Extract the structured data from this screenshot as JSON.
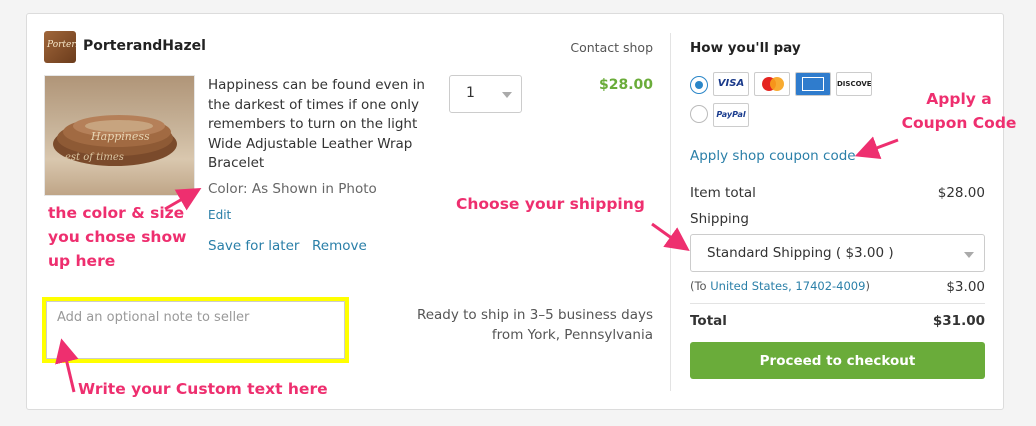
{
  "shop": {
    "name": "PorterandHazel",
    "logo_text": "PorterHazel",
    "contact_label": "Contact shop"
  },
  "item": {
    "title": "Happiness can be found even in the darkest of times if one only remembers to turn on the light Wide Adjustable Leather Wrap Bracelet",
    "image_text": [
      "Happiness",
      "est of times"
    ],
    "color": "Color: As Shown in Photo",
    "edit_label": "Edit",
    "save_label": "Save for later",
    "remove_label": "Remove",
    "quantity": "1",
    "price": "$28.00",
    "note_placeholder": "Add an optional note to seller",
    "ships_line1": "Ready to ship in 3–5 business days",
    "ships_line2": "from York, Pennsylvania"
  },
  "payment": {
    "title": "How you'll pay",
    "cards": {
      "visa": "VISA",
      "mastercard": "",
      "amex": "",
      "discover": "DISCOVER",
      "paypal": "PayPal"
    },
    "selected_method": "cards",
    "coupon_label": "Apply shop coupon code",
    "item_total_label": "Item total",
    "item_total_value": "$28.00",
    "shipping_label": "Shipping",
    "shipping_option": "Standard Shipping ( $3.00 )",
    "ship_to_prefix": "(To ",
    "ship_to_link": "United States, 17402-4009",
    "ship_to_suffix": ")",
    "shipping_cost": "$3.00",
    "total_label": "Total",
    "total_value": "$31.00",
    "checkout_label": "Proceed to checkout"
  },
  "annotations": {
    "color_size": "the color & size you chose show up here",
    "shipping": "Choose your shipping",
    "coupon_line1": "Apply a",
    "coupon_line2": "Coupon Code",
    "custom_text": "Write your Custom text here"
  },
  "colors": {
    "accent_green": "#6aac3a",
    "link_blue": "#2a7fa8",
    "annotation_pink": "#ee2f6f",
    "highlight_yellow": "#ffff00"
  }
}
